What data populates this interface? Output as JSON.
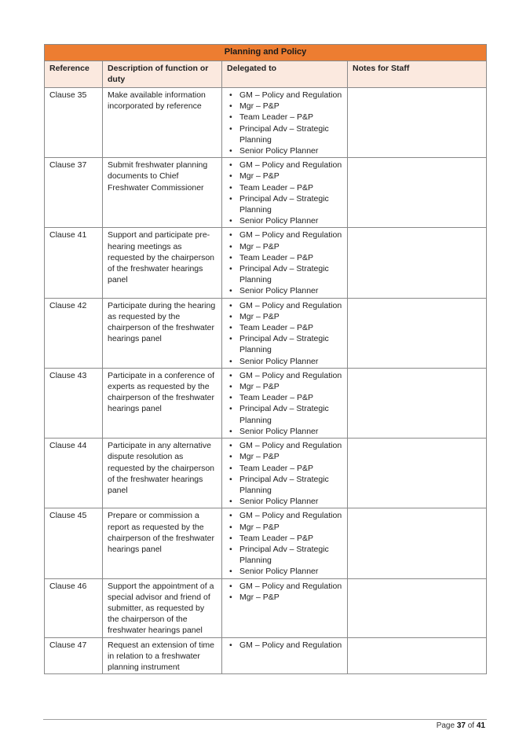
{
  "table": {
    "title": "Planning and Policy",
    "colors": {
      "title_bg": "#ed7d31",
      "header_bg": "#fbe9df",
      "border": "#8a8a8a"
    },
    "headers": [
      "Reference",
      "Description of function or duty",
      "Delegated to",
      "Notes for Staff"
    ],
    "rows": [
      {
        "reference": "Clause 35",
        "description": "Make available information incorporated by reference",
        "delegated_to": [
          "GM – Policy and Regulation",
          "Mgr – P&P",
          "Team Leader – P&P",
          "Principal Adv – Strategic Planning",
          "Senior Policy Planner"
        ],
        "notes": ""
      },
      {
        "reference": "Clause 37",
        "description": "Submit freshwater planning documents to Chief Freshwater Commissioner",
        "delegated_to": [
          "GM – Policy and Regulation",
          "Mgr – P&P",
          "Team Leader – P&P",
          "Principal Adv – Strategic Planning",
          "Senior Policy Planner"
        ],
        "notes": ""
      },
      {
        "reference": "Clause 41",
        "description": "Support and participate pre-hearing meetings as requested by the chairperson of the freshwater hearings panel",
        "delegated_to": [
          "GM – Policy and Regulation",
          "Mgr – P&P",
          "Team Leader – P&P",
          "Principal Adv – Strategic Planning",
          "Senior Policy Planner"
        ],
        "notes": ""
      },
      {
        "reference": "Clause 42",
        "description": "Participate during the hearing as requested by the chairperson of the freshwater hearings panel",
        "delegated_to": [
          "GM – Policy and Regulation",
          "Mgr – P&P",
          "Team Leader – P&P",
          "Principal Adv – Strategic Planning",
          "Senior Policy Planner"
        ],
        "notes": ""
      },
      {
        "reference": "Clause 43",
        "description": "Participate in a conference of experts as requested by the chairperson of the freshwater hearings panel",
        "delegated_to": [
          "GM – Policy and Regulation",
          "Mgr – P&P",
          "Team Leader – P&P",
          "Principal Adv – Strategic Planning",
          "Senior Policy Planner"
        ],
        "notes": ""
      },
      {
        "reference": "Clause 44",
        "description": "Participate in any alternative dispute resolution as requested by the chairperson of the freshwater hearings panel",
        "delegated_to": [
          "GM – Policy and Regulation",
          "Mgr – P&P",
          "Team Leader – P&P",
          "Principal Adv – Strategic Planning",
          "Senior Policy Planner"
        ],
        "notes": ""
      },
      {
        "reference": "Clause 45",
        "description": "Prepare or commission a report as requested by the chairperson of the freshwater hearings panel",
        "delegated_to": [
          "GM – Policy and Regulation",
          "Mgr – P&P",
          "Team Leader – P&P",
          "Principal Adv – Strategic Planning",
          "Senior Policy Planner"
        ],
        "notes": ""
      },
      {
        "reference": "Clause 46",
        "description": "Support the appointment of a special advisor and friend of submitter, as requested by the chairperson of the freshwater hearings panel",
        "delegated_to": [
          "GM – Policy and Regulation",
          "Mgr – P&P"
        ],
        "notes": ""
      },
      {
        "reference": "Clause 47",
        "description": "Request an extension of time in relation to a freshwater planning instrument",
        "delegated_to": [
          "GM – Policy and Regulation"
        ],
        "notes": ""
      }
    ]
  },
  "footer": {
    "page_prefix": "Page",
    "current_page": "37",
    "of_label": "of",
    "total_pages": "41"
  }
}
